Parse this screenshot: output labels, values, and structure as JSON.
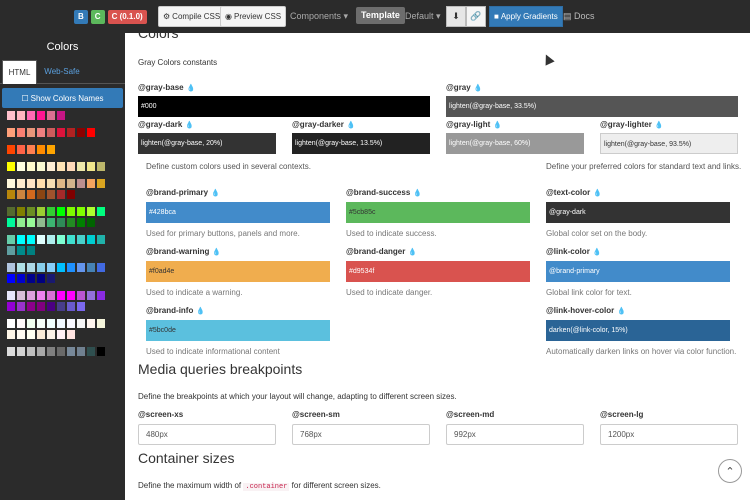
{
  "topbar": {
    "logos": [
      "B",
      "C",
      "C (0.1.0)"
    ],
    "logo_colors": [
      "#337ab7",
      "#5cb85c",
      "#d9534f"
    ],
    "compile_label": "Compile CSS",
    "preview_label": "Preview CSS",
    "components_label": "Components",
    "template_label": "Template",
    "default_label": "Default",
    "apply_gradients_label": "Apply Gradients",
    "docs_label": "Docs"
  },
  "sidebar": {
    "title": "Colors",
    "tabs": [
      "HTML",
      "Web-Safe"
    ],
    "show_colors_label": "Show Colors Names",
    "swatch_rows": [
      [
        "#ffc0cb",
        "#ffb6c1",
        "#ff69b4",
        "#ff1493",
        "#db7093",
        "#c71585"
      ],
      [
        "#ffa07a",
        "#fa8072",
        "#e9967a",
        "#f08080",
        "#cd5c5c",
        "#dc143c",
        "#b22222",
        "#8b0000",
        "#ff0000"
      ],
      [
        "#ff4500",
        "#ff6347",
        "#ff7f50",
        "#ff8c00",
        "#ffa500"
      ],
      [
        "#ffff00",
        "#ffffe0",
        "#fffacd",
        "#fafad2",
        "#ffefd5",
        "#ffe4b5",
        "#ffdab9",
        "#eee8aa",
        "#f0e68c",
        "#bdb76b"
      ],
      [
        "#fff8dc",
        "#ffebcd",
        "#ffe4c4",
        "#ffdead",
        "#f5deb3",
        "#deb887",
        "#d2b48c",
        "#bc8f8f",
        "#f4a460",
        "#daa520",
        "#b8860b",
        "#cd853f",
        "#d2691e",
        "#8b4513",
        "#a0522d",
        "#a52a2a",
        "#800000"
      ],
      [
        "#556b2f",
        "#808000",
        "#6b8e23",
        "#9acd32",
        "#32cd32",
        "#00ff00",
        "#7cfc00",
        "#7fff00",
        "#adff2f",
        "#00ff7f",
        "#00fa9a",
        "#90ee90",
        "#98fb98",
        "#8fbc8f",
        "#3cb371",
        "#2e8b57",
        "#228b22",
        "#008000",
        "#006400"
      ],
      [
        "#66cdaa",
        "#00ffff",
        "#00ffff",
        "#e0ffff",
        "#afeeee",
        "#7fffd4",
        "#40e0d0",
        "#48d1cc",
        "#00ced1",
        "#20b2aa",
        "#5f9ea0",
        "#008b8b",
        "#008080"
      ],
      [
        "#b0c4de",
        "#b0e0e6",
        "#add8e6",
        "#87ceeb",
        "#87cefa",
        "#00bfff",
        "#1e90ff",
        "#6495ed",
        "#4682b4",
        "#4169e1",
        "#0000ff",
        "#0000cd",
        "#00008b",
        "#000080",
        "#191970"
      ],
      [
        "#e6e6fa",
        "#d8bfd8",
        "#dda0dd",
        "#ee82ee",
        "#da70d6",
        "#ff00ff",
        "#ff00ff",
        "#ba55d3",
        "#9370db",
        "#8a2be2",
        "#9400d3",
        "#9932cc",
        "#8b008b",
        "#800080",
        "#4b0082",
        "#483d8b",
        "#6a5acd",
        "#7b68ee"
      ],
      [
        "#ffffff",
        "#fffafa",
        "#f0fff0",
        "#f5fffa",
        "#f0ffff",
        "#f0f8ff",
        "#f8f8ff",
        "#f5f5f5",
        "#fff5ee",
        "#f5f5dc",
        "#fdf5e6",
        "#fffaf0",
        "#fffff0",
        "#faebd7",
        "#faf0e6",
        "#fff0f5",
        "#ffe4e1"
      ],
      [
        "#dcdcdc",
        "#d3d3d3",
        "#c0c0c0",
        "#a9a9a9",
        "#808080",
        "#696969",
        "#778899",
        "#708090",
        "#2f4f4f",
        "#000000"
      ]
    ]
  },
  "main": {
    "gray_constants_label": "Gray Colors constants",
    "gray_base": {
      "name": "@gray-base",
      "value": "#000",
      "color": "#000000",
      "text_color": "#ffffff"
    },
    "gray": {
      "name": "@gray",
      "value": "lighten(@gray-base, 33.5%)",
      "color": "#555555",
      "text_color": "#ffffff"
    },
    "gray_small": [
      {
        "name": "@gray-dark",
        "value": "lighten(@gray-base, 20%)",
        "color": "#333333",
        "text_color": "#ffffff"
      },
      {
        "name": "@gray-darker",
        "value": "lighten(@gray-base, 13.5%)",
        "color": "#222222",
        "text_color": "#ffffff"
      },
      {
        "name": "@gray-light",
        "value": "lighten(@gray-base, 60%)",
        "color": "#999999",
        "text_color": "#ffffff"
      },
      {
        "name": "@gray-lighter",
        "value": "lighten(@gray-base, 93.5%)",
        "color": "#eeeeee",
        "text_color": "#333333"
      }
    ],
    "custom_colors_desc": "Define custom colors used in several contexts.",
    "preferred_colors_desc": "Define your preferred colors for standard text and links.",
    "brand": [
      {
        "name": "@brand-primary",
        "value": "#428bca",
        "color": "#428bca",
        "text_color": "#ffffff",
        "desc": "Used for primary buttons, panels and more."
      },
      {
        "name": "@brand-success",
        "value": "#5cb85c",
        "color": "#5cb85c",
        "text_color": "#333333",
        "desc": "Used to indicate success."
      },
      {
        "name": "@text-color",
        "value": "@gray-dark",
        "color": "#333333",
        "text_color": "#ffffff",
        "desc": "Global color set on the body."
      },
      {
        "name": "@brand-warning",
        "value": "#f0ad4e",
        "color": "#f0ad4e",
        "text_color": "#333333",
        "desc": "Used to indicate a warning."
      },
      {
        "name": "@brand-danger",
        "value": "#d9534f",
        "color": "#d9534f",
        "text_color": "#ffffff",
        "desc": "Used to indicate danger."
      },
      {
        "name": "@link-color",
        "value": "@brand-primary",
        "color": "#428bca",
        "text_color": "#ffffff",
        "desc": "Global link color for text."
      },
      {
        "name": "@brand-info",
        "value": "#5bc0de",
        "color": "#5bc0de",
        "text_color": "#333333",
        "desc": "Used to indicate informational content"
      },
      {
        "name": "@link-hover-color",
        "value": "darken(@link-color, 15%)",
        "color": "#2a6496",
        "text_color": "#ffffff",
        "desc": "Automatically darken links on hover via color function."
      }
    ],
    "media_heading": "Media queries breakpoints",
    "media_desc": "Define the breakpoints at which your layout will change, adapting to different screen sizes.",
    "screens": [
      {
        "name": "@screen-xs",
        "value": "480px"
      },
      {
        "name": "@screen-sm",
        "value": "768px"
      },
      {
        "name": "@screen-md",
        "value": "992px"
      },
      {
        "name": "@screen-lg",
        "value": "1200px"
      }
    ],
    "container_heading": "Container sizes",
    "container_desc_pre": "Define the maximum width of",
    "container_code": ".container",
    "container_desc_post": "for different screen sizes."
  }
}
